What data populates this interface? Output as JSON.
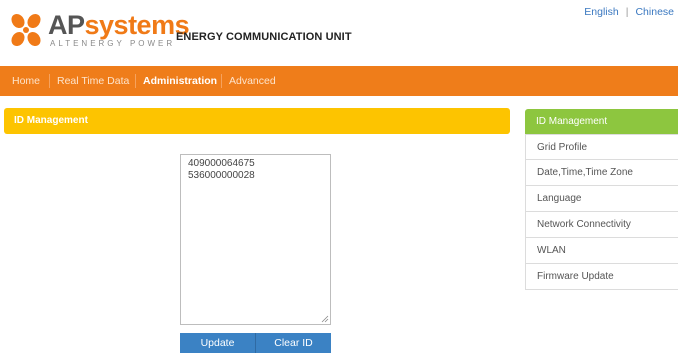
{
  "brand": {
    "name_part1": "AP",
    "name_part2": "systems",
    "tagline": "ALTENERGY POWER",
    "title": "ENERGY COMMUNICATION UNIT"
  },
  "language": {
    "english": "English",
    "separator": "|",
    "chinese": "Chinese"
  },
  "nav": {
    "items": [
      {
        "label": "Home"
      },
      {
        "label": "Real Time Data"
      },
      {
        "label": "Administration"
      },
      {
        "label": "Advanced"
      }
    ],
    "active": "Administration"
  },
  "panel": {
    "title": "ID Management",
    "ids": [
      "409000064675",
      "536000000028"
    ],
    "update_label": "Update",
    "clear_label": "Clear ID"
  },
  "sidebar": {
    "title": "ID Management",
    "items": [
      {
        "label": "Grid Profile"
      },
      {
        "label": "Date,Time,Time Zone"
      },
      {
        "label": "Language"
      },
      {
        "label": "Network Connectivity"
      },
      {
        "label": "WLAN"
      },
      {
        "label": "Firmware Update"
      }
    ]
  },
  "colors": {
    "nav_bg": "#ef7d1a",
    "panel_header": "#fdc400",
    "sidebar_header": "#8dc63f",
    "button": "#3b82c4"
  },
  "icons": {
    "logo": "apsystems-logo-icon",
    "resize": "resize-grip-icon"
  }
}
